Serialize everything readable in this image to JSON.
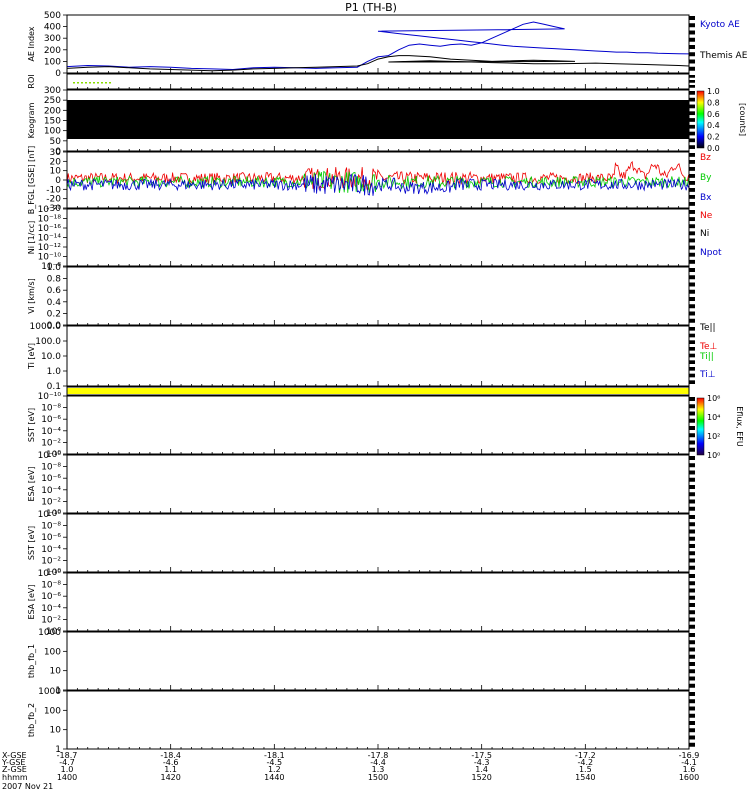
{
  "title": "P1 (TH-B)",
  "colors": {
    "blue": "#0000cc",
    "red": "#ee0000",
    "green": "#00cc00",
    "black": "#000000",
    "yellow": "#ffff00",
    "lime": "#88dd00"
  },
  "chart_data": [
    {
      "id": "ae",
      "type": "line",
      "ylabel": "AE Index",
      "ylim": [
        0,
        500
      ],
      "yticks": [
        "0",
        "100",
        "200",
        "300",
        "400",
        "500"
      ],
      "series": [
        {
          "name": "Kyoto AE",
          "color": "#0000cc",
          "x": [
            1400,
            1404,
            1408,
            1412,
            1416,
            1420,
            1424,
            1428,
            1432,
            1436,
            1440,
            1444,
            1448,
            1452,
            1456,
            1458,
            1460,
            1462,
            1464,
            1466,
            1468,
            1470,
            1472,
            1474,
            1476,
            1478,
            1480,
            1482,
            1484,
            1486,
            1488,
            1490,
            1492,
            1494,
            1496,
            1500,
            1504,
            1508,
            1512,
            1516,
            1518,
            1520,
            1522,
            1524,
            1526,
            1528,
            1530,
            1532,
            1534,
            1536,
            1538,
            1540,
            1542,
            1544,
            1546,
            1548,
            1550,
            1552,
            1554,
            1556,
            1558,
            1560
          ],
          "y": [
            55,
            65,
            60,
            50,
            55,
            50,
            40,
            35,
            30,
            45,
            50,
            45,
            40,
            45,
            50,
            100,
            140,
            150,
            200,
            240,
            250,
            240,
            230,
            245,
            250,
            240,
            260,
            300,
            340,
            380,
            420,
            440,
            420,
            400,
            380,
            360,
            340,
            320,
            300,
            280,
            270,
            260,
            250,
            240,
            230,
            225,
            220,
            215,
            210,
            205,
            200,
            195,
            190,
            185,
            180,
            180,
            175,
            175,
            170,
            168,
            166,
            165
          ]
        },
        {
          "name": "Themis AE",
          "color": "#000000",
          "x": [
            1400,
            1404,
            1408,
            1412,
            1416,
            1420,
            1424,
            1428,
            1432,
            1436,
            1440,
            1444,
            1448,
            1452,
            1456,
            1458,
            1460,
            1462,
            1464,
            1466,
            1470,
            1474,
            1478,
            1482,
            1486,
            1490,
            1494,
            1498,
            1502,
            1506,
            1510,
            1514,
            1518,
            1522,
            1526,
            1530,
            1534,
            1538,
            1542,
            1546,
            1550,
            1554,
            1558,
            1560
          ],
          "y": [
            40,
            50,
            55,
            45,
            35,
            30,
            25,
            20,
            25,
            35,
            40,
            45,
            50,
            55,
            60,
            80,
            120,
            140,
            150,
            150,
            140,
            120,
            110,
            100,
            105,
            110,
            105,
            100,
            95,
            100,
            105,
            100,
            95,
            90,
            85,
            80,
            80,
            82,
            85,
            80,
            75,
            70,
            65,
            60
          ]
        }
      ]
    },
    {
      "id": "roi",
      "type": "line",
      "ylabel": "ROI"
    },
    {
      "id": "keogram",
      "type": "heatmap",
      "ylabel": "Keogram",
      "ylim": [
        0,
        300
      ],
      "yticks": [
        "0",
        "50",
        "100",
        "150",
        "200",
        "250",
        "300"
      ],
      "colorbar": {
        "label": "[counts]",
        "ticks": [
          "0.0",
          "0.2",
          "0.4",
          "0.6",
          "0.8",
          "1.0"
        ]
      }
    },
    {
      "id": "bfgl",
      "type": "line",
      "ylabel": "B_FGL [GSE] [nT]",
      "ylim": [
        -30,
        30
      ],
      "yticks": [
        "-30",
        "-20",
        "-10",
        "0",
        "10",
        "20",
        "30"
      ],
      "series": [
        {
          "name": "Bz",
          "color": "#ee0000"
        },
        {
          "name": "By",
          "color": "#00cc00"
        },
        {
          "name": "Bx",
          "color": "#0000cc"
        }
      ]
    },
    {
      "id": "ni",
      "type": "line",
      "ylabel": "Ni [1/cc]",
      "yticks": [
        "10⁻⁸",
        "10⁻¹⁰",
        "10⁻¹²",
        "10⁻¹⁴",
        "10⁻¹⁶",
        "10⁻¹⁸",
        "10⁻²⁰"
      ],
      "series": [
        {
          "name": "Ne",
          "color": "#ee0000"
        },
        {
          "name": "Ni",
          "color": "#000000"
        },
        {
          "name": "Npot",
          "color": "#0000cc"
        }
      ]
    },
    {
      "id": "vi",
      "type": "line",
      "ylabel": "Vi [km/s]",
      "ylim": [
        0,
        1
      ],
      "yticks": [
        "0.0",
        "0.2",
        "0.4",
        "0.6",
        "0.8",
        "1.0"
      ]
    },
    {
      "id": "ti",
      "type": "line",
      "ylabel": "Ti [eV]",
      "yticks": [
        "0.1",
        "1.0",
        "10.0",
        "100.0",
        "1000.0"
      ],
      "series": [
        {
          "name": "Te||",
          "color": "#000000"
        },
        {
          "name": "Te⊥",
          "color": "#ee0000"
        },
        {
          "name": "Ti||",
          "color": "#00cc00"
        },
        {
          "name": "Ti⊥",
          "color": "#0000cc"
        }
      ]
    },
    {
      "id": "mode",
      "type": "bar",
      "color": "#ffff00"
    },
    {
      "id": "sst1",
      "type": "heatmap",
      "ylabel": "SST [eV]",
      "yticks": [
        "10⁰",
        "10⁻²",
        "10⁻⁴",
        "10⁻⁶",
        "10⁻⁸",
        "10⁻¹⁰"
      ],
      "colorbar": {
        "label": "Eflux, EFU",
        "ticks": [
          "10⁰",
          "10²",
          "10⁴",
          "10⁶"
        ]
      }
    },
    {
      "id": "esa1",
      "type": "heatmap",
      "ylabel": "ESA [eV]",
      "yticks": [
        "10⁰",
        "10⁻²",
        "10⁻⁴",
        "10⁻⁶",
        "10⁻⁸",
        "10⁻¹⁰"
      ]
    },
    {
      "id": "sst2",
      "type": "heatmap",
      "ylabel": "SST [eV]",
      "yticks": [
        "10⁰",
        "10⁻²",
        "10⁻⁴",
        "10⁻⁶",
        "10⁻⁸",
        "10⁻¹⁰"
      ]
    },
    {
      "id": "esa2",
      "type": "heatmap",
      "ylabel": "ESA [eV]",
      "yticks": [
        "10⁰",
        "10⁻²",
        "10⁻⁴",
        "10⁻⁶",
        "10⁻⁸",
        "10⁻¹⁰"
      ]
    },
    {
      "id": "fb1",
      "type": "line",
      "ylabel": "thb_fb_1",
      "yticks": [
        "1",
        "10",
        "100",
        "1000"
      ]
    },
    {
      "id": "fb2",
      "type": "line",
      "ylabel": "thb_fb_2",
      "yticks": [
        "1",
        "10",
        "100",
        "1000"
      ]
    }
  ],
  "x_axis": {
    "range": [
      1400,
      1600
    ],
    "major_ticks": [
      1400,
      1420,
      1440,
      1500,
      1520,
      1540,
      1600
    ],
    "rows": [
      {
        "label": "X-GSE",
        "values": [
          "-18.7",
          "-18.4",
          "-18.1",
          "-17.8",
          "-17.5",
          "-17.2",
          "-16.9"
        ]
      },
      {
        "label": "Y-GSE",
        "values": [
          "-4.7",
          "-4.6",
          "-4.5",
          "-4.4",
          "-4.3",
          "-4.2",
          "-4.1"
        ]
      },
      {
        "label": "Z-GSE",
        "values": [
          "1.0",
          "1.1",
          "1.2",
          "1.3",
          "1.4",
          "1.5",
          "1.6"
        ]
      },
      {
        "label": "hhmm",
        "values": [
          "1400",
          "1420",
          "1440",
          "1500",
          "1520",
          "1540",
          "1600"
        ]
      }
    ],
    "date": "2007 Nov 21"
  }
}
